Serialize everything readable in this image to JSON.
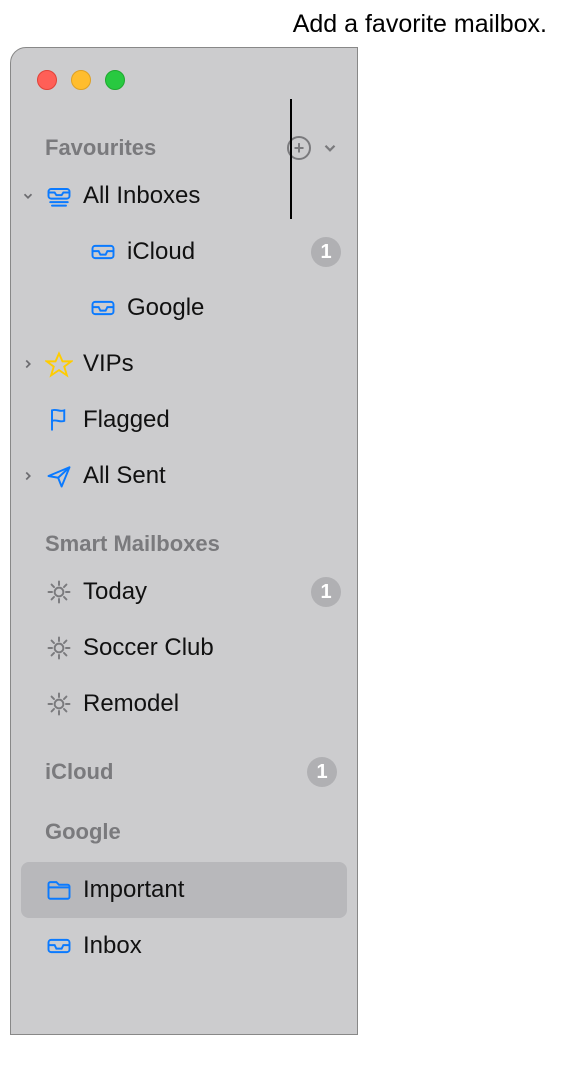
{
  "callout": "Add a favorite mailbox.",
  "sections": {
    "favourites": {
      "title": "Favourites",
      "items": {
        "all_inboxes": {
          "label": "All Inboxes"
        },
        "icloud": {
          "label": "iCloud",
          "badge": "1"
        },
        "google": {
          "label": "Google"
        },
        "vips": {
          "label": "VIPs"
        },
        "flagged": {
          "label": "Flagged"
        },
        "all_sent": {
          "label": "All Sent"
        }
      }
    },
    "smart": {
      "title": "Smart Mailboxes",
      "items": {
        "today": {
          "label": "Today",
          "badge": "1"
        },
        "soccer": {
          "label": "Soccer Club"
        },
        "remodel": {
          "label": "Remodel"
        }
      }
    },
    "icloud": {
      "title": "iCloud",
      "badge": "1"
    },
    "google_acct": {
      "title": "Google",
      "items": {
        "important": {
          "label": "Important"
        },
        "inbox": {
          "label": "Inbox"
        }
      }
    }
  }
}
